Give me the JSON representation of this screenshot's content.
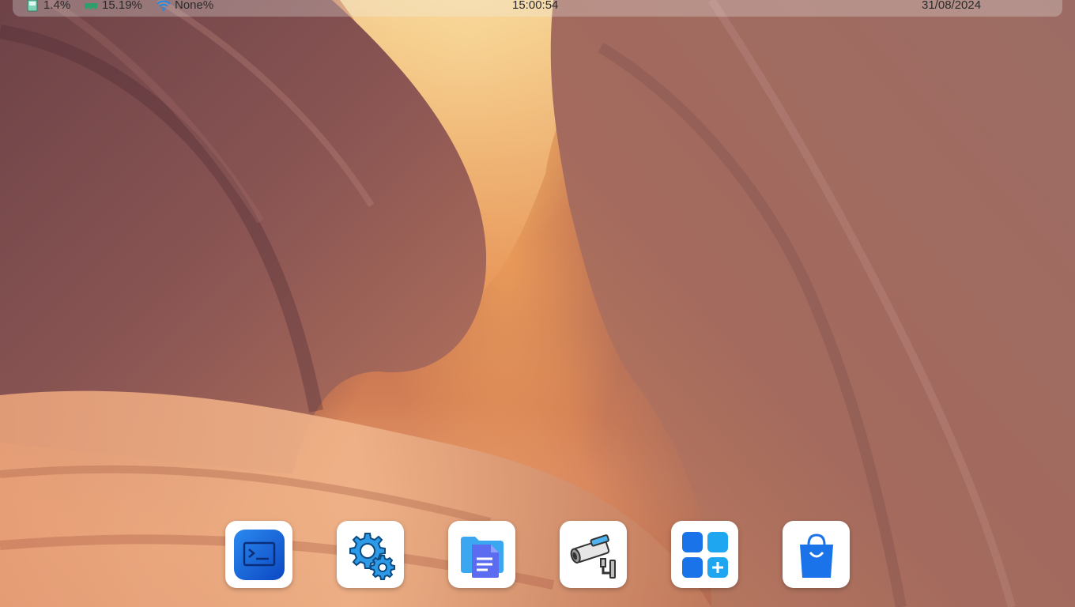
{
  "topbar": {
    "cpu": {
      "icon": "sd-card-icon",
      "value": "1.4%"
    },
    "memory": {
      "icon": "ram-icon",
      "value": "15.19%"
    },
    "network": {
      "icon": "wifi-icon",
      "value": "None%"
    },
    "clock": "15:00:54",
    "date": "31/08/2024"
  },
  "dock": {
    "apps": [
      {
        "name": "terminal",
        "icon": "terminal-icon"
      },
      {
        "name": "settings",
        "icon": "gears-icon"
      },
      {
        "name": "files",
        "icon": "folder-document-icon"
      },
      {
        "name": "camera",
        "icon": "security-camera-icon"
      },
      {
        "name": "app-store",
        "icon": "apps-grid-add-icon"
      },
      {
        "name": "store",
        "icon": "shopping-bag-icon"
      }
    ]
  },
  "colors": {
    "accent_blue": "#1a73e8",
    "light_blue": "#3aa7f0",
    "ram_green": "#2f9e6a",
    "wifi_blue": "#1e88e5"
  }
}
